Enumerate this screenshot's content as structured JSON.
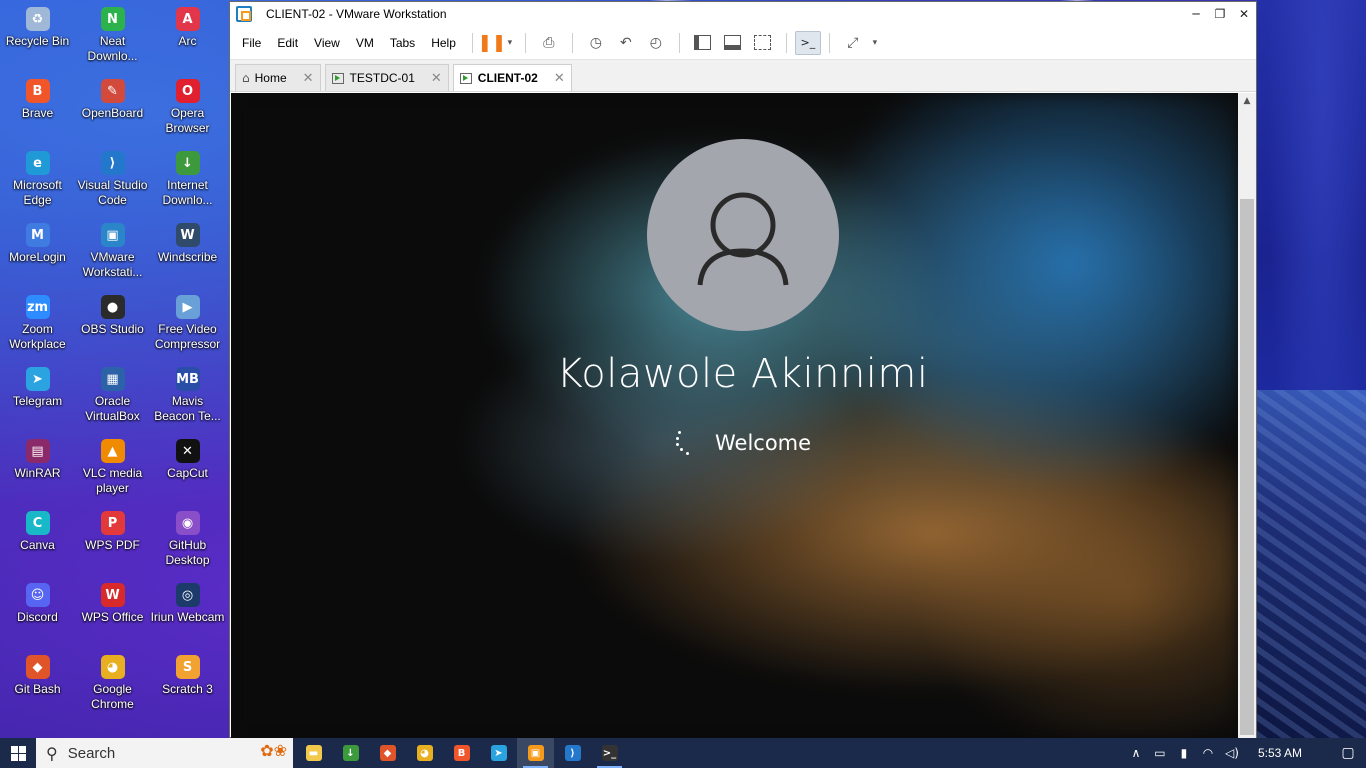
{
  "desktop": {
    "icons": [
      {
        "label": "Recycle Bin",
        "icon": "recycle-bin-icon",
        "color": "#9fb8d8",
        "glyph": "♻"
      },
      {
        "label": "Neat Downlo...",
        "icon": "neat-download-icon",
        "color": "#2bb24c",
        "glyph": "N"
      },
      {
        "label": "Arc",
        "icon": "arc-icon",
        "color": "#e2364a",
        "glyph": "A"
      },
      {
        "label": "Brave",
        "icon": "brave-icon",
        "color": "#f1562b",
        "glyph": "B"
      },
      {
        "label": "OpenBoard",
        "icon": "openboard-icon",
        "color": "#d24a3c",
        "glyph": "✎"
      },
      {
        "label": "Opera Browser",
        "icon": "opera-icon",
        "color": "#e0202f",
        "glyph": "O"
      },
      {
        "label": "Microsoft Edge",
        "icon": "edge-icon",
        "color": "#1f9ad6",
        "glyph": "e"
      },
      {
        "label": "Visual Studio Code",
        "icon": "vscode-icon",
        "color": "#2478cc",
        "glyph": "⟩"
      },
      {
        "label": "Internet Downlo...",
        "icon": "idm-icon",
        "color": "#3c9a3c",
        "glyph": "↓"
      },
      {
        "label": "MoreLogin",
        "icon": "morelogin-icon",
        "color": "#3f7be0",
        "glyph": "M"
      },
      {
        "label": "VMware Workstati...",
        "icon": "vmware-icon",
        "color": "#2a86c8",
        "glyph": "▣"
      },
      {
        "label": "Windscribe",
        "icon": "windscribe-icon",
        "color": "#2f4a6a",
        "glyph": "W"
      },
      {
        "label": "Zoom Workplace",
        "icon": "zoom-icon",
        "color": "#2d8cff",
        "glyph": "zm"
      },
      {
        "label": "OBS Studio",
        "icon": "obs-icon",
        "color": "#2b2b2b",
        "glyph": "●"
      },
      {
        "label": "Free Video Compressor",
        "icon": "video-compressor-icon",
        "color": "#6aa0d8",
        "glyph": "▶"
      },
      {
        "label": "Telegram",
        "icon": "telegram-icon",
        "color": "#2aa3e0",
        "glyph": "➤"
      },
      {
        "label": "Oracle VirtualBox",
        "icon": "virtualbox-icon",
        "color": "#2c62a8",
        "glyph": "▦"
      },
      {
        "label": "Mavis Beacon Te...",
        "icon": "mavis-beacon-icon",
        "color": "#2a4da8",
        "glyph": "MB"
      },
      {
        "label": "WinRAR",
        "icon": "winrar-icon",
        "color": "#8b2a6a",
        "glyph": "▤"
      },
      {
        "label": "VLC media player",
        "icon": "vlc-icon",
        "color": "#f08a00",
        "glyph": "▲"
      },
      {
        "label": "CapCut",
        "icon": "capcut-icon",
        "color": "#111111",
        "glyph": "✕"
      },
      {
        "label": "Canva",
        "icon": "canva-icon",
        "color": "#18b8c8",
        "glyph": "C"
      },
      {
        "label": "WPS PDF",
        "icon": "wps-pdf-icon",
        "color": "#e23a3a",
        "glyph": "P"
      },
      {
        "label": "GitHub Desktop",
        "icon": "github-desktop-icon",
        "color": "#8a4ec8",
        "glyph": "◉"
      },
      {
        "label": "Discord",
        "icon": "discord-icon",
        "color": "#5865f2",
        "glyph": "☺"
      },
      {
        "label": "WPS Office",
        "icon": "wps-office-icon",
        "color": "#d82a2a",
        "glyph": "W"
      },
      {
        "label": "Iriun Webcam",
        "icon": "iriun-webcam-icon",
        "color": "#1c3a6a",
        "glyph": "◎"
      },
      {
        "label": "Git Bash",
        "icon": "git-bash-icon",
        "color": "#e0542a",
        "glyph": "◆"
      },
      {
        "label": "Google Chrome",
        "icon": "chrome-icon",
        "color": "#e8b020",
        "glyph": "◕"
      },
      {
        "label": "Scratch 3",
        "icon": "scratch-icon",
        "color": "#f2a230",
        "glyph": "S"
      }
    ]
  },
  "window": {
    "title": "CLIENT-02 - VMware Workstation",
    "minimize": "─",
    "restore": "❐",
    "close": "✕"
  },
  "menu": {
    "items": [
      "File",
      "Edit",
      "View",
      "VM",
      "Tabs",
      "Help"
    ],
    "pause_icon": "❚❚",
    "dropdown_arrow": "▾",
    "send_keys_icon": "⎙",
    "snapshot_icon": "◷",
    "revert_snapshot_icon": "↶",
    "snapshot_manager_icon": "◴",
    "console_icon": ">_",
    "fullscreen_icon": "⤢"
  },
  "tabs": [
    {
      "label": "Home",
      "icon": "home-icon",
      "active": false
    },
    {
      "label": "TESTDC-01",
      "icon": "vm-icon",
      "active": false
    },
    {
      "label": "CLIENT-02",
      "icon": "vm-icon",
      "active": true
    }
  ],
  "tab_close": "✕",
  "guest": {
    "username": "Kolawole Akinnimi",
    "status": "Welcome"
  },
  "scrollbar": {
    "up_arrow": "▲"
  },
  "taskbar": {
    "search_placeholder": "Search",
    "search_icon": "⚲",
    "search_deco": "✿❀",
    "apps": [
      {
        "name": "file-explorer-icon",
        "color": "#f2c94c",
        "glyph": "▬",
        "running": false,
        "active": false
      },
      {
        "name": "idm-taskbar-icon",
        "color": "#3c9a3c",
        "glyph": "↓",
        "running": false,
        "active": false
      },
      {
        "name": "git-taskbar-icon",
        "color": "#e0542a",
        "glyph": "◆",
        "running": false,
        "active": false
      },
      {
        "name": "chrome-taskbar-icon",
        "color": "#e8b020",
        "glyph": "◕",
        "running": false,
        "active": false
      },
      {
        "name": "brave-taskbar-icon",
        "color": "#f1562b",
        "glyph": "B",
        "running": false,
        "active": false
      },
      {
        "name": "telegram-taskbar-icon",
        "color": "#2aa3e0",
        "glyph": "➤",
        "running": false,
        "active": false
      },
      {
        "name": "vmware-taskbar-icon",
        "color": "#f59a1b",
        "glyph": "▣",
        "running": true,
        "active": true
      },
      {
        "name": "vscode-taskbar-icon",
        "color": "#2478cc",
        "glyph": "⟩",
        "running": false,
        "active": false
      },
      {
        "name": "terminal-taskbar-icon",
        "color": "#333333",
        "glyph": ">_",
        "running": true,
        "active": false
      }
    ],
    "tray": {
      "overflow_icon": "∧",
      "meet_icon": "▭",
      "battery_icon": "▮",
      "wifi_icon": "◠",
      "volume_icon": "◁)",
      "time": "5:53 AM",
      "notifications_icon": "▢"
    }
  }
}
